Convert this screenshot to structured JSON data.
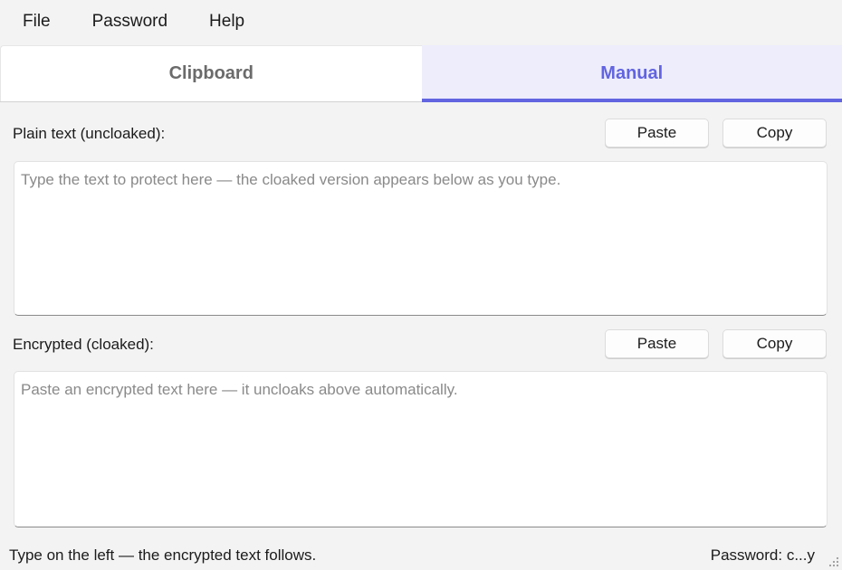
{
  "menu": {
    "items": [
      "File",
      "Password",
      "Help"
    ]
  },
  "tabs": {
    "clipboard": "Clipboard",
    "manual": "Manual",
    "active": "manual"
  },
  "plain": {
    "label": "Plain text (uncloaked):",
    "paste_label": "Paste",
    "copy_label": "Copy",
    "value": "",
    "placeholder": "Type the text to protect here — the cloaked version appears below as you type."
  },
  "encrypted": {
    "label": "Encrypted (cloaked):",
    "paste_label": "Paste",
    "copy_label": "Copy",
    "value": "",
    "placeholder": "Paste an encrypted text here — it uncloaks above automatically."
  },
  "status": {
    "message": "Type on the left — the encrypted text follows.",
    "password": "Password: c...y"
  },
  "colors": {
    "accent": "#6264e0",
    "active_tab_bg": "#ededfc",
    "window_bg": "#f3f3f3"
  }
}
